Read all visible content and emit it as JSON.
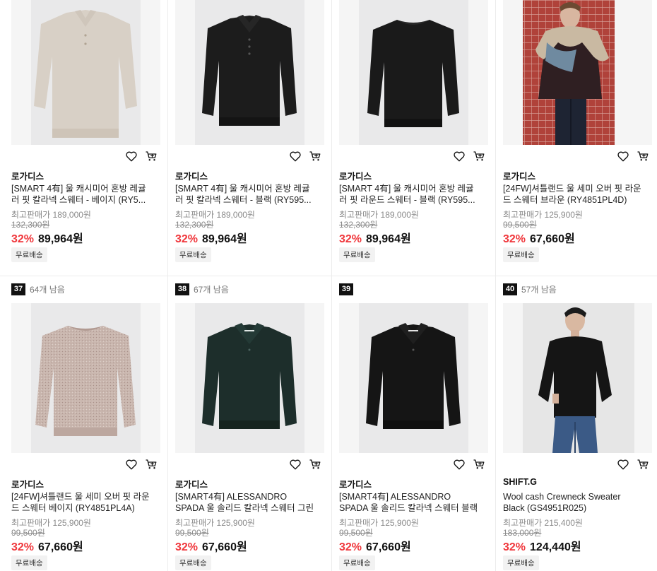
{
  "colors": {
    "discount": "#f0373c",
    "price": "#111111",
    "rank_badge_bg": "#111111",
    "shipping_badge_bg": "#f2f2f2"
  },
  "icons": {
    "wishlist": "heart-outline-icon",
    "cart": "cart-icon"
  },
  "row1": [
    {
      "brand": "로가디스",
      "title": "[SMART 4有] 울 캐시미어 혼방 레귤러 핏 칼라넥 스웨터 - 베이지 (RY5...",
      "orig_label": "최고판매가 189,000원",
      "list_price": "132,300원",
      "discount": "32%",
      "price": "89,964원",
      "shipping": "무료배송",
      "image": {
        "desc": "beige-polo-sweater",
        "bg": "#e9e9ea",
        "garment": "#d8d0c6"
      }
    },
    {
      "brand": "로가디스",
      "title": "[SMART 4有] 울 캐시미어 혼방 레귤러 핏 칼라넥 스웨터 - 블랙 (RY595...",
      "orig_label": "최고판매가 189,000원",
      "list_price": "132,300원",
      "discount": "32%",
      "price": "89,964원",
      "shipping": "무료배송",
      "image": {
        "desc": "black-polo-sweater",
        "bg": "#e9e9ea",
        "garment": "#1c1c1c"
      }
    },
    {
      "brand": "로가디스",
      "title": "[SMART 4有] 울 캐시미어 혼방 레귤러 핏 라운드 스웨터 - 블랙 (RY595...",
      "orig_label": "최고판매가 189,000원",
      "list_price": "132,300원",
      "discount": "32%",
      "price": "89,964원",
      "shipping": "무료배송",
      "image": {
        "desc": "black-crewneck-sweater",
        "bg": "#e9e9ea",
        "garment": "#1a1a1a"
      }
    },
    {
      "brand": "로가디스",
      "title": "[24FW]셔틀랜드 울 세미 오버 핏 라운드 스웨터 브라운 (RY4851PL4D)",
      "orig_label": "최고판매가 125,900원",
      "list_price": "99,500원",
      "discount": "32%",
      "price": "67,660원",
      "shipping": "무료배송",
      "image": {
        "desc": "model-brown-sweater-scarf",
        "bg": "#b7453d",
        "garment": "#2f1f22"
      }
    }
  ],
  "row2": [
    {
      "rank": "37",
      "remaining": "64개 남음",
      "brand": "로가디스",
      "title": "[24FW]셔틀랜드 울 세미 오버 핏 라운드 스웨터 베이지 (RY4851PL4A)",
      "orig_label": "최고판매가 125,900원",
      "list_price": "99,500원",
      "discount": "32%",
      "price": "67,660원",
      "shipping": "무료배송",
      "image": {
        "desc": "beige-melange-crewneck",
        "bg": "#e9e9ea",
        "garment": "#c8b5ad"
      }
    },
    {
      "rank": "38",
      "remaining": "67개 남음",
      "brand": "로가디스",
      "title": "[SMART4有] ALESSANDRO SPADA 울 솔리드 칼라넥 스웨터 그린 (...",
      "orig_label": "최고판매가 125,900원",
      "list_price": "99,500원",
      "discount": "32%",
      "price": "67,660원",
      "shipping": "무료배송",
      "image": {
        "desc": "dark-green-polo-sweater",
        "bg": "#e9e9ea",
        "garment": "#1d2e2b"
      }
    },
    {
      "rank": "39",
      "remaining": "",
      "brand": "로가디스",
      "title": "[SMART4有] ALESSANDRO SPADA 울 솔리드 칼라넥 스웨터 블랙 (...",
      "orig_label": "최고판매가 125,900원",
      "list_price": "99,500원",
      "discount": "32%",
      "price": "67,660원",
      "shipping": "무료배송",
      "image": {
        "desc": "black-polo-sweater",
        "bg": "#e9e9ea",
        "garment": "#151515"
      }
    },
    {
      "rank": "40",
      "remaining": "57개 남음",
      "brand": "SHIFT.G",
      "title": "Wool cash Crewneck Sweater Black (GS4951R025)",
      "orig_label": "최고판매가 215,400원",
      "list_price": "183,000원",
      "discount": "32%",
      "price": "124,440원",
      "shipping": "무료배송",
      "image": {
        "desc": "model-black-crewneck-jeans",
        "bg": "#e6e6e6",
        "garment": "#151515"
      }
    }
  ]
}
